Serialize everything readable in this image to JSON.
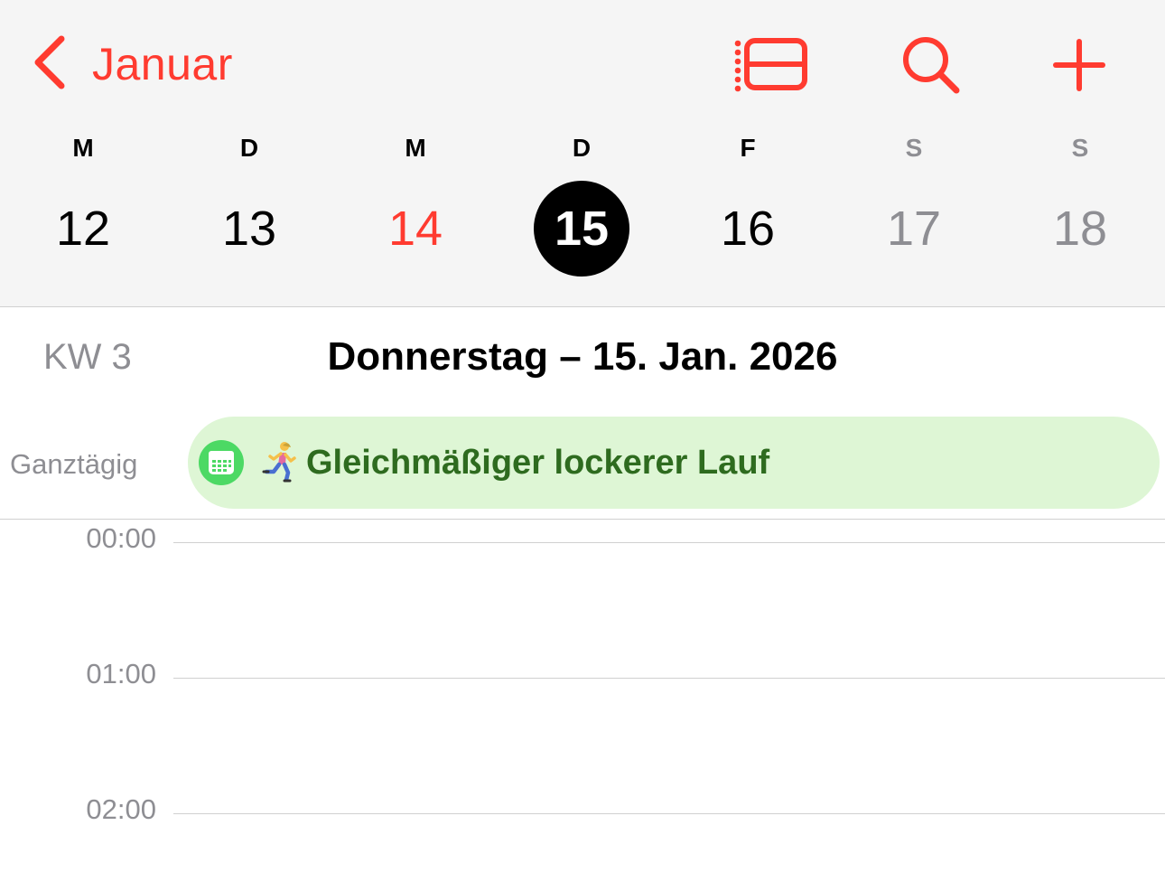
{
  "nav": {
    "back_label": "Januar",
    "accent_color": "#ff3b30",
    "icons": [
      "chevron-left-icon",
      "list-view-icon",
      "search-icon",
      "plus-icon"
    ]
  },
  "week": {
    "weekdays": [
      {
        "label": "M",
        "weekend": false
      },
      {
        "label": "D",
        "weekend": false
      },
      {
        "label": "M",
        "weekend": false
      },
      {
        "label": "D",
        "weekend": false
      },
      {
        "label": "F",
        "weekend": false
      },
      {
        "label": "S",
        "weekend": true
      },
      {
        "label": "S",
        "weekend": true
      }
    ],
    "days": [
      {
        "number": "12",
        "state": "normal"
      },
      {
        "number": "13",
        "state": "normal"
      },
      {
        "number": "14",
        "state": "today"
      },
      {
        "number": "15",
        "state": "selected"
      },
      {
        "number": "16",
        "state": "normal"
      },
      {
        "number": "17",
        "state": "weekend"
      },
      {
        "number": "18",
        "state": "weekend"
      }
    ]
  },
  "day_view": {
    "week_number": "KW 3",
    "date_title": "Donnerstag – 15. Jan. 2026",
    "allday_label": "Ganztägig",
    "event": {
      "emoji": "🏃",
      "title": "Gleichmäßiger lockerer Lauf",
      "calendar_color": "#4cd964",
      "background_color": "#def6d5",
      "text_color": "#2e6b1f"
    },
    "hours": [
      "00:00",
      "01:00",
      "02:00"
    ]
  }
}
